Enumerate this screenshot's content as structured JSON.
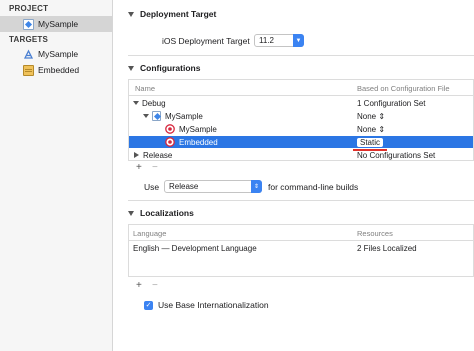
{
  "sidebar": {
    "project_header": "PROJECT",
    "project_item": "MySample",
    "targets_header": "TARGETS",
    "targets": [
      "MySample",
      "Embedded"
    ]
  },
  "deployment": {
    "title": "Deployment Target",
    "label": "iOS Deployment Target",
    "value": "11.2"
  },
  "configurations": {
    "title": "Configurations",
    "col_name": "Name",
    "col_based": "Based on Configuration File",
    "rows": [
      {
        "name": "Debug",
        "based": "1 Configuration Set"
      },
      {
        "name": "MySample",
        "based": "None"
      },
      {
        "name": "MySample",
        "based": "None"
      },
      {
        "name": "Embedded",
        "based": "Static"
      },
      {
        "name": "Release",
        "based": "No Configurations Set"
      }
    ],
    "add_label": "+",
    "remove_label": "−",
    "use_label": "Use",
    "use_value": "Release",
    "use_suffix": "for command-line builds"
  },
  "localizations": {
    "title": "Localizations",
    "col_language": "Language",
    "col_resources": "Resources",
    "rows": [
      {
        "language": "English — Development Language",
        "resources": "2 Files Localized"
      }
    ],
    "add_label": "+",
    "remove_label": "−",
    "base_checkbox_label": "Use Base Internationalization"
  },
  "colors": {
    "selection": "#2b76e4",
    "accent": "#3b83f2",
    "annotation_underline": "#e0302a"
  }
}
